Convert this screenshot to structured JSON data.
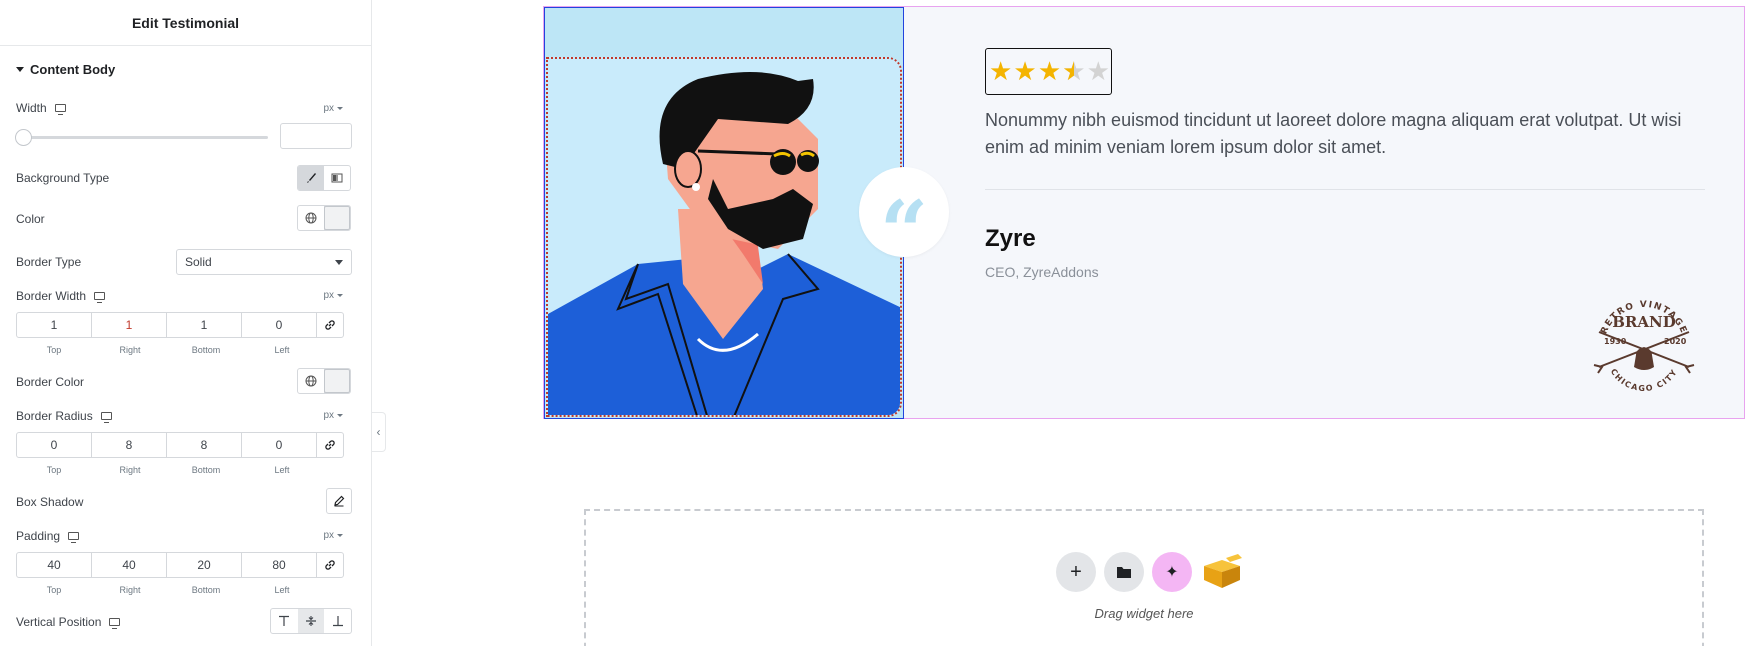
{
  "panel": {
    "title": "Edit Testimonial",
    "section": "Content Body",
    "width": {
      "label": "Width",
      "unit": "px",
      "value": ""
    },
    "background_type": {
      "label": "Background Type"
    },
    "color": {
      "label": "Color"
    },
    "border_type": {
      "label": "Border Type",
      "value": "Solid"
    },
    "border_width": {
      "label": "Border Width",
      "unit": "px",
      "top": "1",
      "right": "1",
      "bottom": "1",
      "left": "0"
    },
    "border_color": {
      "label": "Border Color"
    },
    "border_radius": {
      "label": "Border Radius",
      "unit": "px",
      "top": "0",
      "right": "8",
      "bottom": "8",
      "left": "0"
    },
    "box_shadow": {
      "label": "Box Shadow"
    },
    "padding": {
      "label": "Padding",
      "unit": "px",
      "top": "40",
      "right": "40",
      "bottom": "20",
      "left": "80"
    },
    "vertical_position": {
      "label": "Vertical Position"
    },
    "dim_labels": {
      "top": "Top",
      "right": "Right",
      "bottom": "Bottom",
      "left": "Left"
    },
    "collapse_glyph": "‹"
  },
  "testimonial": {
    "rating": {
      "value": 3.5,
      "max": 5
    },
    "quote_mark": "“",
    "text": "Nonummy nibh euismod tincidunt ut laoreet dolore magna aliquam erat volutpat. Ut wisi enim ad minim veniam lorem ipsum dolor sit amet.",
    "author_name": "Zyre",
    "author_title": "CEO, ZyreAddons",
    "logo": {
      "top_text": "RETRO VINTAGE",
      "brand": "BRAND",
      "year_left": "1930",
      "year_right": "2020",
      "bottom_text": "CHICAGO CITY"
    }
  },
  "dropzone": {
    "label": "Drag widget here",
    "add_icon": "+",
    "ai_icon": "✦"
  },
  "colors": {
    "border_pink": "#e8a3ef",
    "image_bg": "#bde6f6",
    "star": "#f4b400",
    "quote_mark": "#b6e0f3"
  }
}
